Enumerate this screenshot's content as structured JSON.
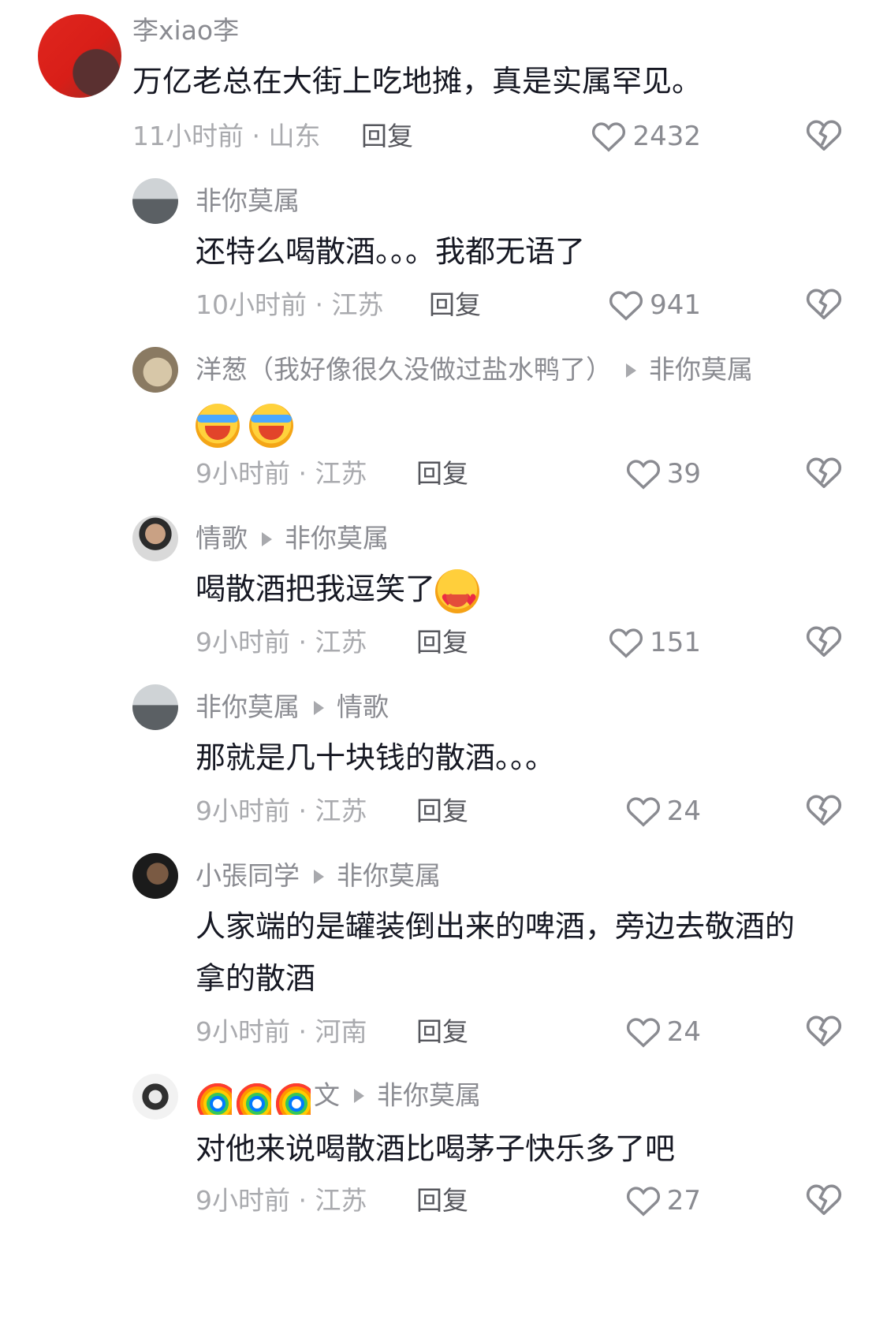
{
  "comments": [
    {
      "avatar": "avatar-flag-portrait",
      "author": "李xiao李",
      "reply_to": "",
      "text": "万亿老总在大街上吃地摊，真是实属罕见。",
      "meta": "11小时前 · 山东",
      "reply_label": "回复",
      "likes": "2432"
    },
    {
      "avatar": "avatar-window",
      "author": "非你莫属",
      "reply_to": "",
      "text": "还特么喝散酒。。。我都无语了",
      "meta": "10小时前 · 江苏",
      "reply_label": "回复",
      "likes": "941"
    },
    {
      "avatar": "avatar-cat",
      "author": "洋葱（我好像很久没做过盐水鸭了）",
      "reply_to": "非你莫属",
      "text": "",
      "emojis": [
        "laughing-crying-emoji",
        "laughing-crying-emoji"
      ],
      "meta": "9小时前 · 江苏",
      "reply_label": "回复",
      "likes": "39"
    },
    {
      "avatar": "avatar-man",
      "author": "情歌",
      "reply_to": "非你莫属",
      "text": "喝散酒把我逗笑了",
      "emojis": [
        "heart-eyes-emoji"
      ],
      "meta": "9小时前 · 江苏",
      "reply_label": "回复",
      "likes": "151"
    },
    {
      "avatar": "avatar-window",
      "author": "非你莫属",
      "reply_to": "情歌",
      "text": "那就是几十块钱的散酒。。。",
      "meta": "9小时前 · 江苏",
      "reply_label": "回复",
      "likes": "24"
    },
    {
      "avatar": "avatar-dark",
      "author": "小張同学",
      "reply_to": "非你莫属",
      "text": "人家端的是罐装倒出来的啤酒，旁边去敬酒的拿的散酒",
      "meta": "9小时前 · 河南",
      "reply_label": "回复",
      "likes": "24"
    },
    {
      "avatar": "avatar-bw",
      "author": "文",
      "author_prefix_icons": [
        "rainbow-icon",
        "rainbow-icon",
        "rainbow-icon"
      ],
      "reply_to": "非你莫属",
      "text": "对他来说喝散酒比喝茅子快乐多了吧",
      "meta": "9小时前 · 江苏",
      "reply_label": "回复",
      "likes": "27"
    }
  ],
  "colors": {
    "text": "#161823",
    "name": "#8a8b91",
    "meta": "#a9aaae",
    "reply": "#55565c"
  },
  "icons": {
    "like": "heart-outline-icon",
    "dislike": "broken-heart-icon",
    "reply_arrow": "triangle-right-icon"
  }
}
